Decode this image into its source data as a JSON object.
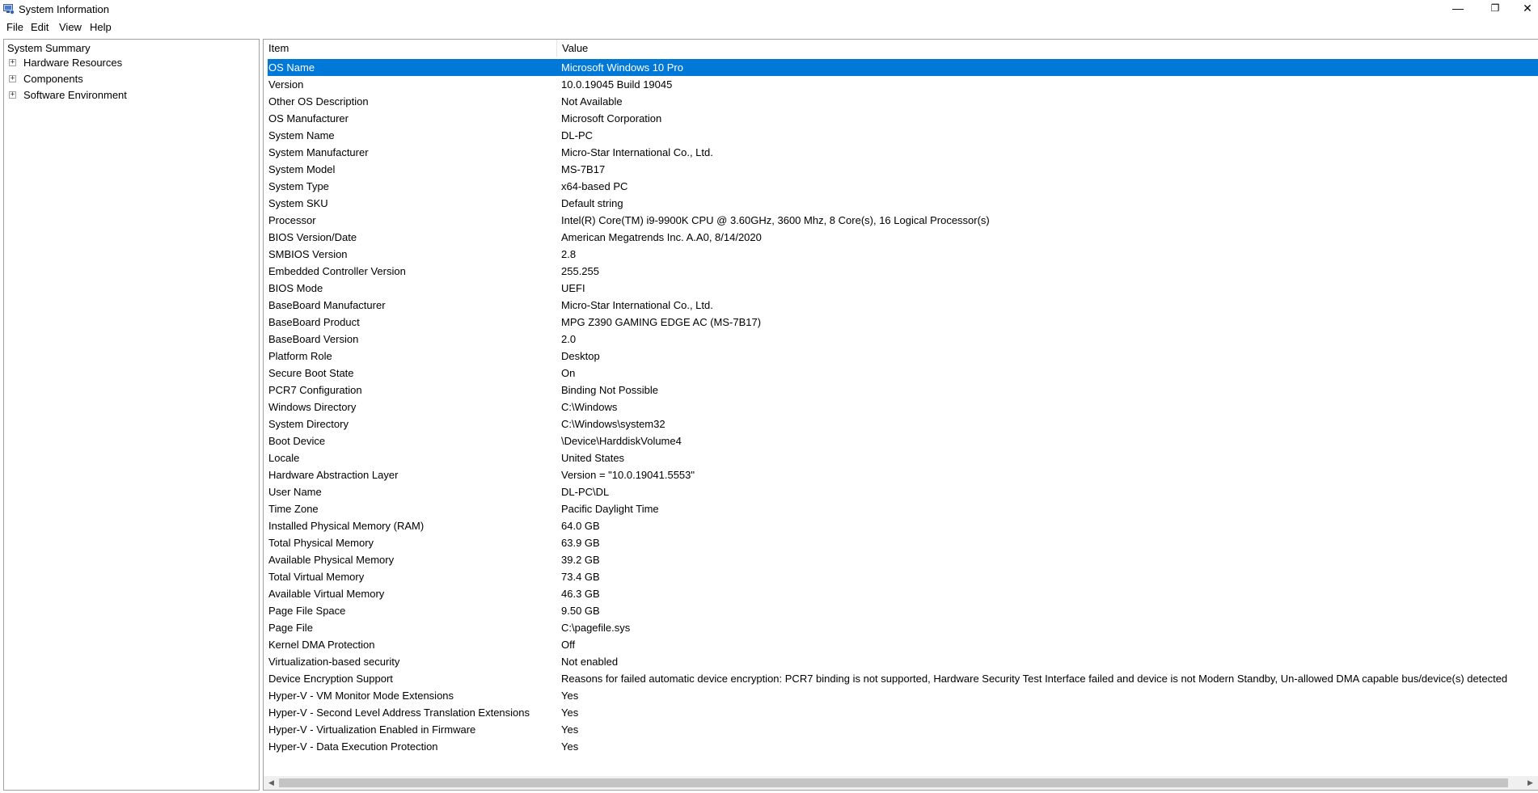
{
  "window": {
    "title": "System Information",
    "controls": {
      "minimize": "—",
      "restore": "❐",
      "close": "✕"
    }
  },
  "menu": [
    "File",
    "Edit",
    "View",
    "Help"
  ],
  "tree": {
    "root": "System Summary",
    "nodes": [
      "Hardware Resources",
      "Components",
      "Software Environment"
    ],
    "expander_symbol": "+"
  },
  "table": {
    "headers": {
      "item": "Item",
      "value": "Value"
    },
    "rows": [
      {
        "item": "OS Name",
        "value": "Microsoft Windows 10 Pro"
      },
      {
        "item": "Version",
        "value": "10.0.19045 Build 19045"
      },
      {
        "item": "Other OS Description",
        "value": "Not Available"
      },
      {
        "item": "OS Manufacturer",
        "value": "Microsoft Corporation"
      },
      {
        "item": "System Name",
        "value": "DL-PC"
      },
      {
        "item": "System Manufacturer",
        "value": "Micro-Star International Co., Ltd."
      },
      {
        "item": "System Model",
        "value": "MS-7B17"
      },
      {
        "item": "System Type",
        "value": "x64-based PC"
      },
      {
        "item": "System SKU",
        "value": "Default string"
      },
      {
        "item": "Processor",
        "value": "Intel(R) Core(TM) i9-9900K CPU @ 3.60GHz, 3600 Mhz, 8 Core(s), 16 Logical Processor(s)"
      },
      {
        "item": "BIOS Version/Date",
        "value": "American Megatrends Inc. A.A0, 8/14/2020"
      },
      {
        "item": "SMBIOS Version",
        "value": "2.8"
      },
      {
        "item": "Embedded Controller Version",
        "value": "255.255"
      },
      {
        "item": "BIOS Mode",
        "value": "UEFI"
      },
      {
        "item": "BaseBoard Manufacturer",
        "value": "Micro-Star International Co., Ltd."
      },
      {
        "item": "BaseBoard Product",
        "value": "MPG Z390 GAMING EDGE AC (MS-7B17)"
      },
      {
        "item": "BaseBoard Version",
        "value": "2.0"
      },
      {
        "item": "Platform Role",
        "value": "Desktop"
      },
      {
        "item": "Secure Boot State",
        "value": "On"
      },
      {
        "item": "PCR7 Configuration",
        "value": "Binding Not Possible"
      },
      {
        "item": "Windows Directory",
        "value": "C:\\Windows"
      },
      {
        "item": "System Directory",
        "value": "C:\\Windows\\system32"
      },
      {
        "item": "Boot Device",
        "value": "\\Device\\HarddiskVolume4"
      },
      {
        "item": "Locale",
        "value": "United States"
      },
      {
        "item": "Hardware Abstraction Layer",
        "value": "Version = \"10.0.19041.5553\""
      },
      {
        "item": "User Name",
        "value": "DL-PC\\DL"
      },
      {
        "item": "Time Zone",
        "value": "Pacific Daylight Time"
      },
      {
        "item": "Installed Physical Memory (RAM)",
        "value": "64.0 GB"
      },
      {
        "item": "Total Physical Memory",
        "value": "63.9 GB"
      },
      {
        "item": "Available Physical Memory",
        "value": "39.2 GB"
      },
      {
        "item": "Total Virtual Memory",
        "value": "73.4 GB"
      },
      {
        "item": "Available Virtual Memory",
        "value": "46.3 GB"
      },
      {
        "item": "Page File Space",
        "value": "9.50 GB"
      },
      {
        "item": "Page File",
        "value": "C:\\pagefile.sys"
      },
      {
        "item": "Kernel DMA Protection",
        "value": "Off"
      },
      {
        "item": "Virtualization-based security",
        "value": "Not enabled"
      },
      {
        "item": "Device Encryption Support",
        "value": "Reasons for failed automatic device encryption: PCR7 binding is not supported, Hardware Security Test Interface failed and device is not Modern Standby, Un-allowed DMA capable bus/device(s) detected"
      },
      {
        "item": "Hyper-V - VM Monitor Mode Extensions",
        "value": "Yes"
      },
      {
        "item": "Hyper-V - Second Level Address Translation Extensions",
        "value": "Yes"
      },
      {
        "item": "Hyper-V - Virtualization Enabled in Firmware",
        "value": "Yes"
      },
      {
        "item": "Hyper-V - Data Execution Protection",
        "value": "Yes"
      }
    ],
    "selected_row": 0
  },
  "scrollbar": {
    "left_arrow": "◀",
    "right_arrow": "▶"
  },
  "colors": {
    "selection": "#0078d7",
    "border": "#a0a0a0"
  }
}
